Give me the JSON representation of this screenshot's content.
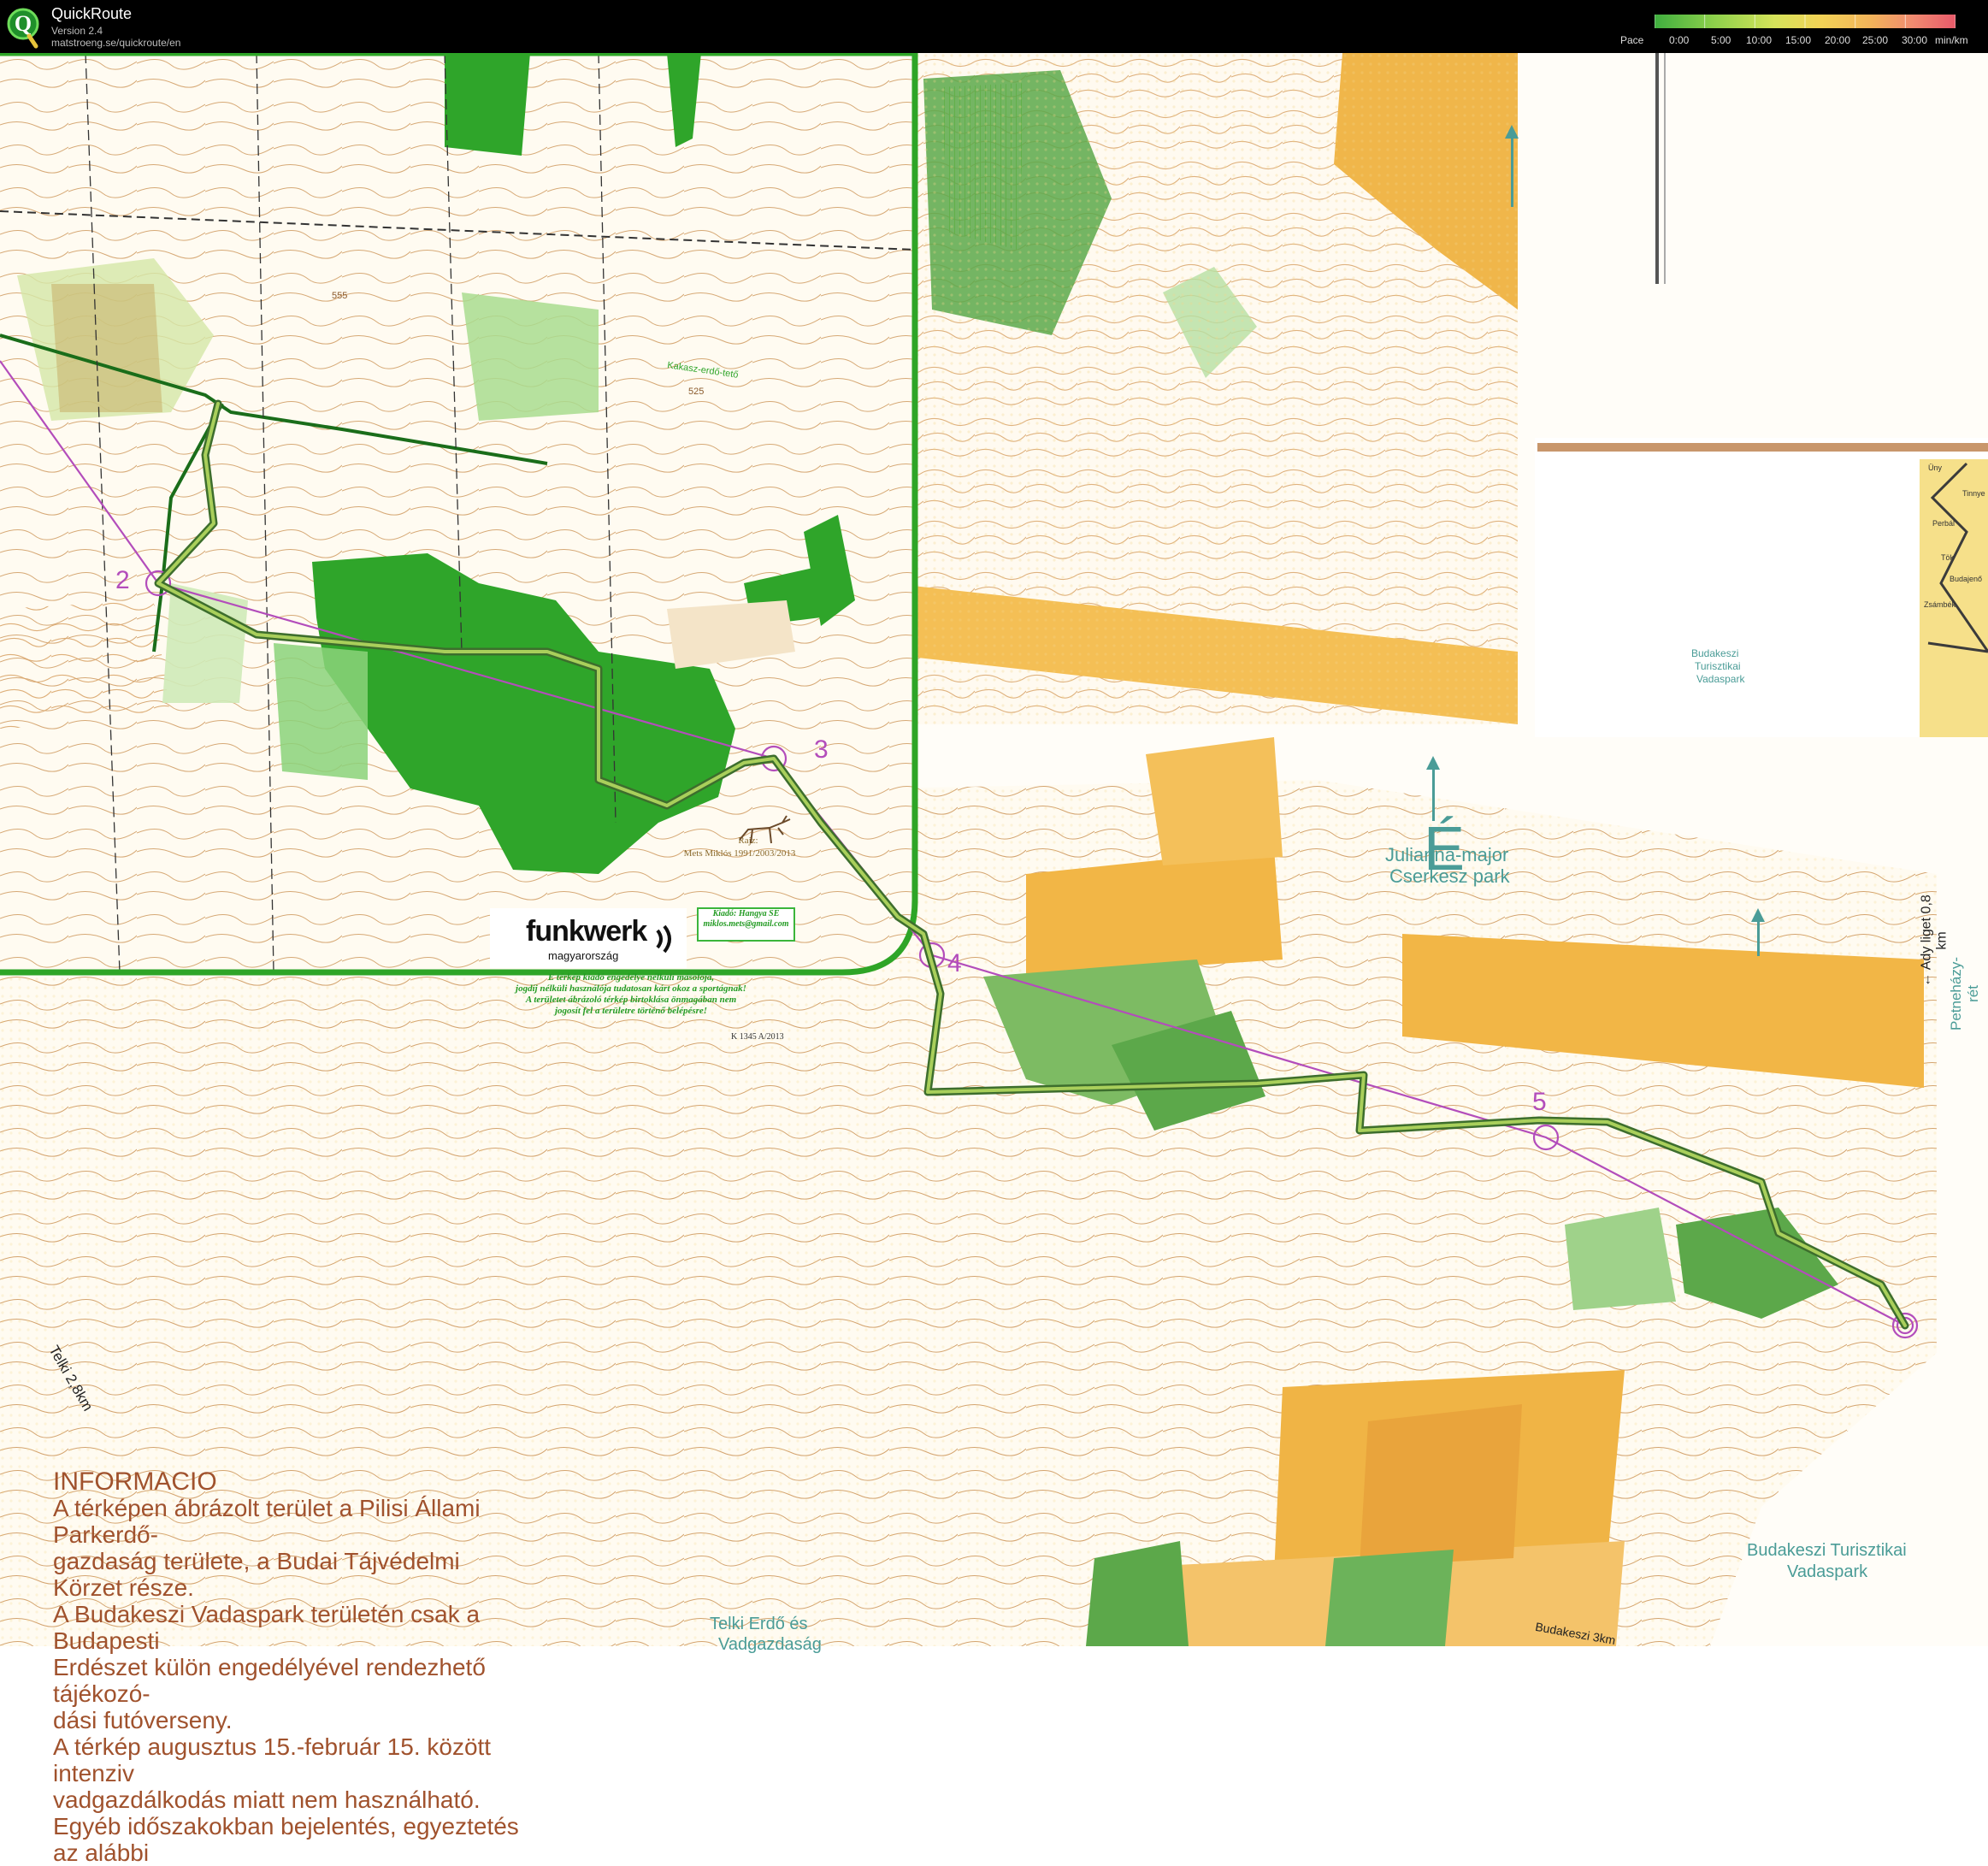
{
  "app": {
    "title": "QuickRoute",
    "version": "Version 2.4",
    "url": "matstroeng.se/quickroute/en"
  },
  "pace_legend": {
    "label": "Pace",
    "ticks": [
      "0:00",
      "5:00",
      "10:00",
      "15:00",
      "20:00",
      "25:00",
      "30:00"
    ],
    "unit": "min/km",
    "colors": [
      "#3fae3f",
      "#8ed14b",
      "#d6e35a",
      "#f2d356",
      "#f2b35a",
      "#f08a70",
      "#e85a6a"
    ]
  },
  "map": {
    "info": {
      "title": "INFORMACIO",
      "lines": [
        "A térképen ábrázolt terület a Pilisi Állami Parkerdő-",
        "gazdaság területe, a Budai Tájvédelmi Körzet része.",
        "A Budakeszi Vadaspark területén csak a Budapesti",
        "Erdészet külön engedélyével rendezhető tájékozó-",
        "dási futóverseny.",
        "A térkép augusztus 15.-február 15. között intenziv",
        "vadgazdálkodás miatt nem használható.",
        "Egyéb időszakokban bejelentés, egyeztetés az alábbi"
      ]
    },
    "north_letter": "É",
    "places": {
      "julianna": "Julianna-major",
      "cserkesz": "Cserkesz park",
      "budakeszi_turisztikai_1": "Budakeszi Turisztikai",
      "budakeszi_turisztikai_2": "Vadaspark",
      "budakeszi_small_1": "Budakeszi",
      "budakeszi_small_2": "Turisztikai",
      "budakeszi_small_3": "Vadaspark",
      "telki_1": "Telki Erdő és",
      "telki_2": "Vadgazdaság",
      "telki_arrow": "Telki 2,8km",
      "ady": "← Ady liget 0,8 km",
      "petnehazy": "Petneházy-rét",
      "kakasz": "Kakasz-erdő-tető",
      "budakeszi_road": "Budakeszi 3km",
      "spot_555": "555",
      "spot_525": "525"
    },
    "inset_towns": [
      "Üny",
      "Tinnye",
      "Perbál",
      "Tök",
      "Budajenő",
      "Zsámbék"
    ],
    "controls": [
      "2",
      "3",
      "4",
      "5"
    ],
    "funkwerk": {
      "brand": "funkwerk",
      "sub": "magyarország"
    },
    "drawn_by": [
      "Rajz:",
      "Mets Miklós 1991/2003/2013"
    ],
    "edition": [
      "Kiadó: Hangya SE",
      "miklos.mets@gmail.com"
    ],
    "legal": [
      "E térkép kiadó engedélye nélküli másolója,",
      "jogdíj nélküli használója tudatosan kárt okoz a sportágnak!",
      "A területet ábrázoló térkép birtoklása önmagában nem",
      "jogosít fel a területre történő belépésre!"
    ],
    "map_number": "K 1345 A/2013"
  }
}
